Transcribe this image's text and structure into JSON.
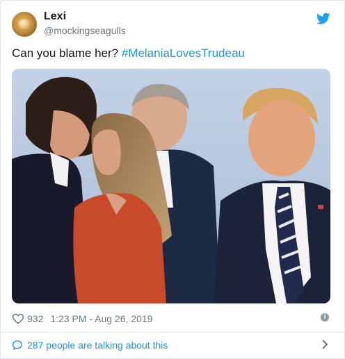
{
  "author": {
    "name": "Lexi",
    "handle": "@mockingseagulls",
    "avatar_icon": "avatar-food-photo"
  },
  "tweet": {
    "text": "Can you blame her?",
    "hashtag": "#MelaniaLovesTrudeau",
    "photo_description_icon": "tweet-photo"
  },
  "meta": {
    "likes": "932",
    "timestamp": "1:23 PM - Aug 26, 2019",
    "info_glyph": "i"
  },
  "conversation": {
    "label": "287 people are talking about this"
  },
  "colors": {
    "link_blue": "#1b95e0",
    "muted_gray": "#657786",
    "twitter_blue": "#1da1f2"
  }
}
